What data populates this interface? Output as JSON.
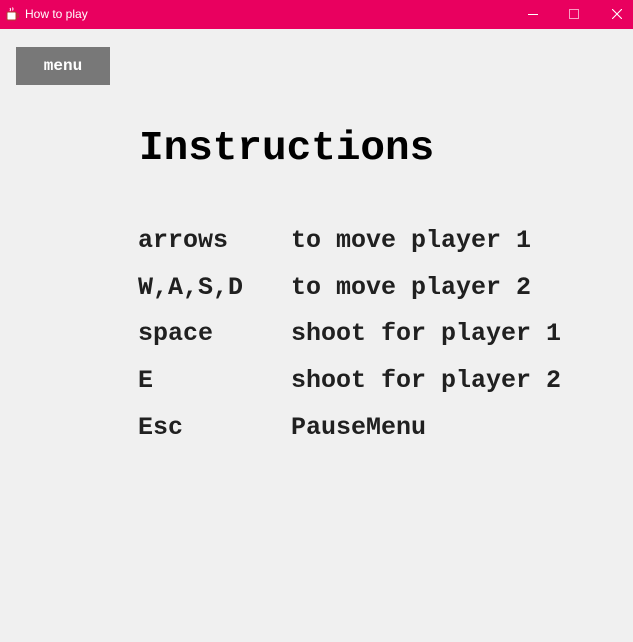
{
  "window": {
    "title": "How to play",
    "titlebar_color": "#e9005f",
    "app_icon": "java-coffee-icon",
    "controls": [
      "minimize-icon",
      "maximize-icon",
      "close-icon"
    ]
  },
  "menu_button": {
    "label": "menu",
    "color": "#787878"
  },
  "heading": "Instructions",
  "instructions": [
    {
      "key": "arrows",
      "action": "to move player 1"
    },
    {
      "key": "W,A,S,D",
      "action": "to move player 2"
    },
    {
      "key": "space",
      "action": "shoot for player 1"
    },
    {
      "key": "E",
      "action": "shoot for player 2"
    },
    {
      "key": "Esc",
      "action": "PauseMenu"
    }
  ]
}
